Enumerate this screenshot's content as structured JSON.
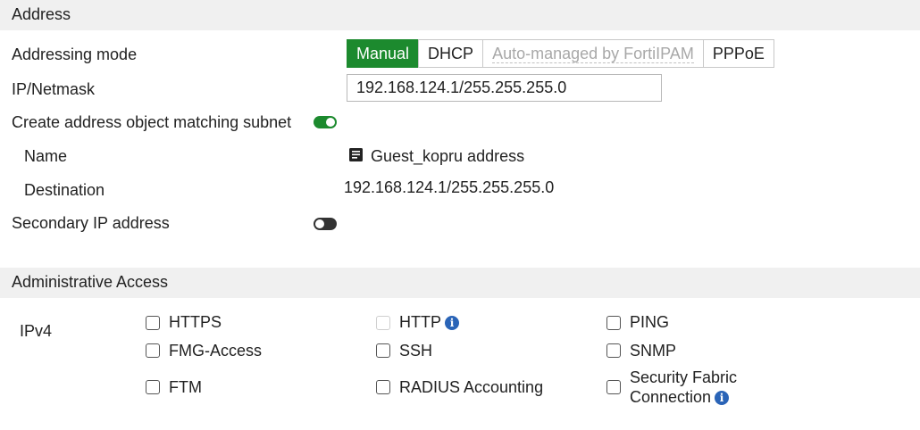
{
  "address_section": {
    "title": "Address",
    "addressing_mode": {
      "label": "Addressing mode",
      "options": [
        "Manual",
        "DHCP",
        "Auto-managed by FortiIPAM",
        "PPPoE"
      ],
      "selected": "Manual"
    },
    "ip_netmask": {
      "label": "IP/Netmask",
      "value": "192.168.124.1/255.255.255.0"
    },
    "create_address_object": {
      "label": "Create address object matching subnet",
      "enabled": true
    },
    "name": {
      "label": "Name",
      "value": "Guest_kopru address",
      "icon": "address-object-icon"
    },
    "destination": {
      "label": "Destination",
      "value": "192.168.124.1/255.255.255.0"
    },
    "secondary_ip": {
      "label": "Secondary IP address",
      "enabled": false
    }
  },
  "admin_access_section": {
    "title": "Administrative Access",
    "ipv4_label": "IPv4",
    "options": {
      "https": "HTTPS",
      "http": "HTTP",
      "ping": "PING",
      "fmg_access": "FMG-Access",
      "ssh": "SSH",
      "snmp": "SNMP",
      "ftm": "FTM",
      "radius_accounting": "RADIUS Accounting",
      "security_fabric_line1": "Security Fabric",
      "security_fabric_line2": "Connection"
    }
  },
  "colors": {
    "accent_green": "#1c8a2e",
    "info_blue": "#2a64b7",
    "section_bg": "#f0f0f0"
  }
}
